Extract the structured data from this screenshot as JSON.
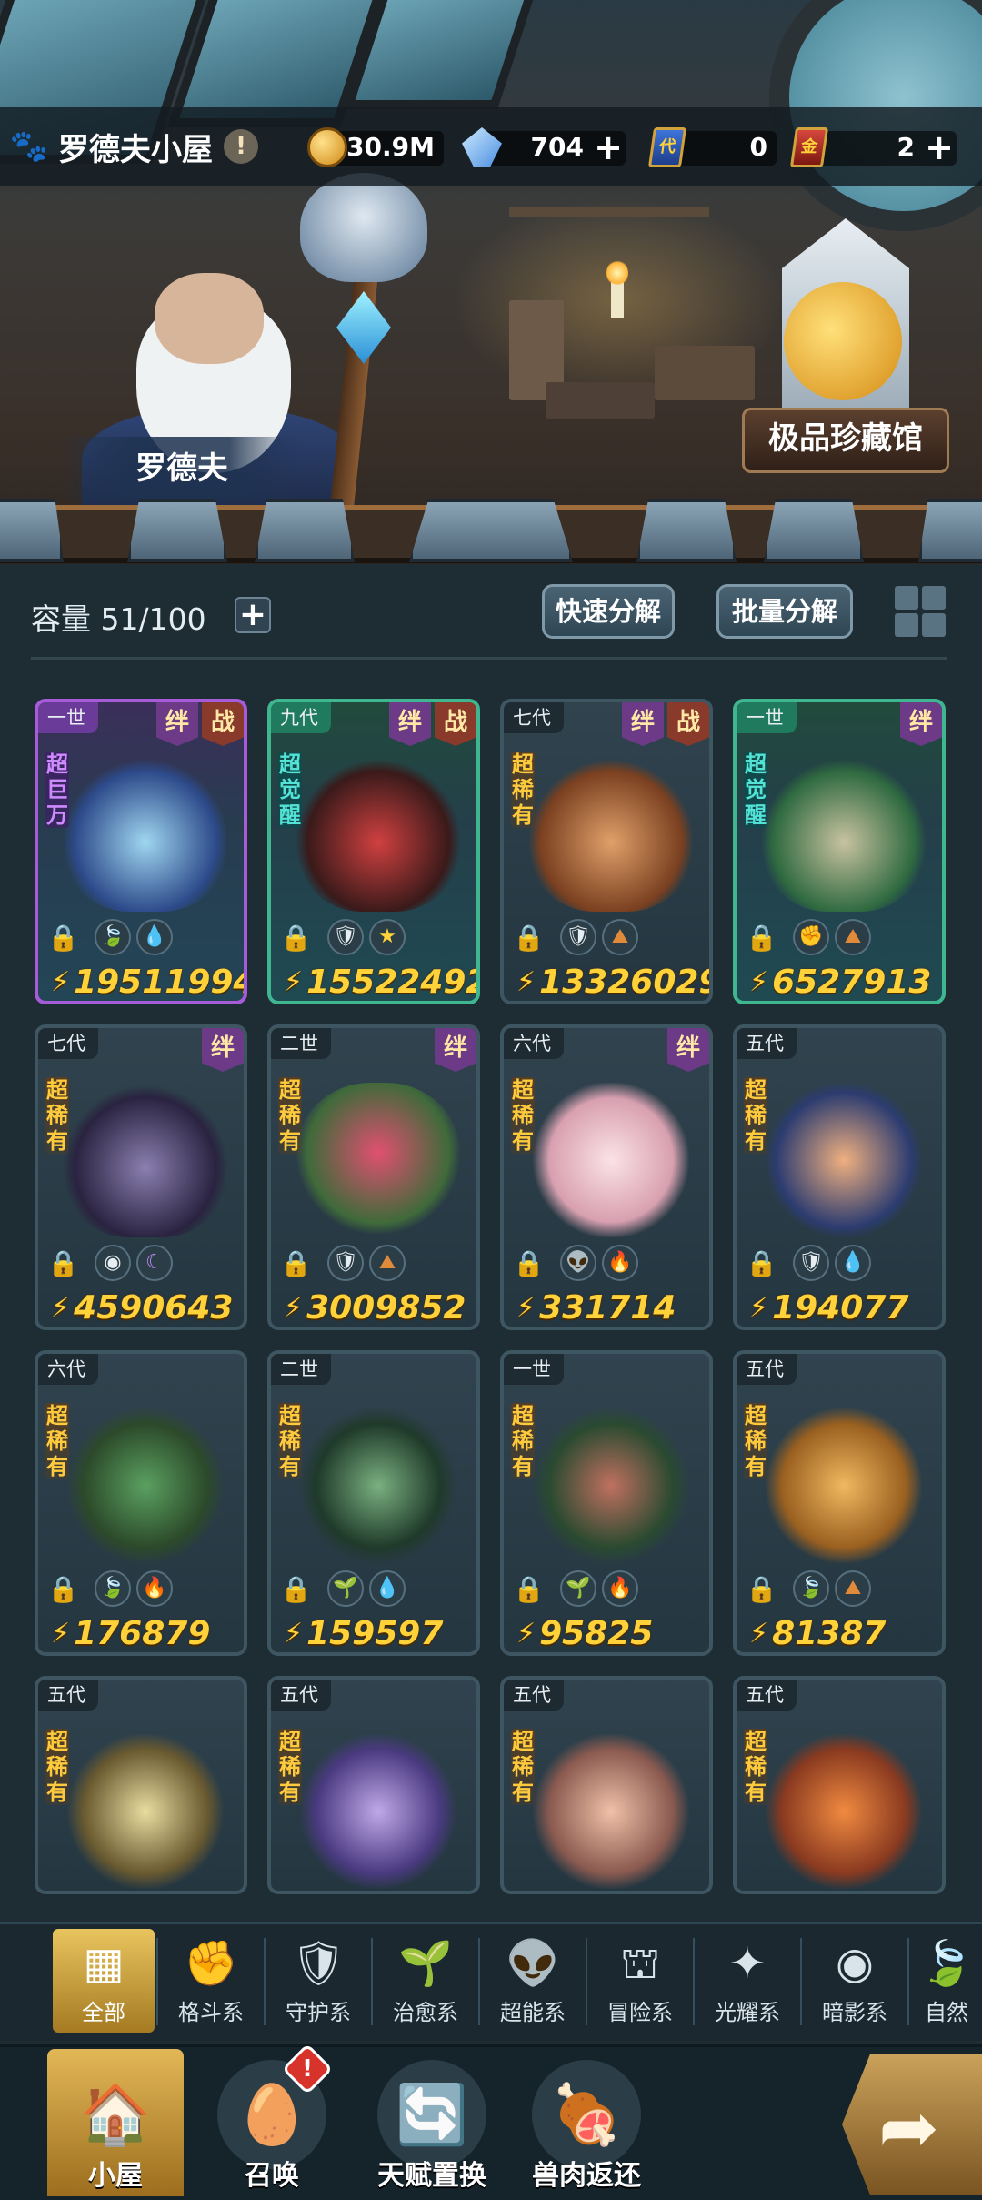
{
  "header": {
    "title": "罗德夫小屋",
    "resources": [
      {
        "icon": "gold-coin-icon",
        "value": "30.9M",
        "has_plus": false
      },
      {
        "icon": "crystal-gem-icon",
        "value": "704",
        "has_plus": true
      },
      {
        "icon": "blue-ticket-icon",
        "value": "0",
        "has_plus": false,
        "ticket_text": "代"
      },
      {
        "icon": "red-ticket-icon",
        "value": "2",
        "has_plus": true,
        "ticket_text": "金"
      }
    ]
  },
  "scene": {
    "character_name": "罗德夫",
    "gallery_button": "极品珍藏馆"
  },
  "storage": {
    "capacity_label": "容量 51/100",
    "quick_decompose": "快速分解",
    "batch_decompose": "批量分解"
  },
  "cards": [
    {
      "gen": "一世",
      "rarity": "超巨万",
      "power": "19511994",
      "badges": [
        "绊",
        "战"
      ],
      "elements": [
        "leaf",
        "water"
      ],
      "frame": "purple"
    },
    {
      "gen": "九代",
      "rarity": "超觉醒",
      "power": "15522492",
      "badges": [
        "绊",
        "战"
      ],
      "elements": [
        "shield",
        "star"
      ],
      "frame": "green"
    },
    {
      "gen": "七代",
      "rarity": "超稀有",
      "power": "13326029",
      "badges": [
        "绊",
        "战"
      ],
      "elements": [
        "shield",
        "earth"
      ],
      "frame": "normal"
    },
    {
      "gen": "一世",
      "rarity": "超觉醒",
      "power": "6527913",
      "badges": [
        "绊"
      ],
      "elements": [
        "fist",
        "earth"
      ],
      "frame": "green"
    },
    {
      "gen": "七代",
      "rarity": "超稀有",
      "power": "4590643",
      "badges": [
        "绊"
      ],
      "elements": [
        "eye",
        "moon"
      ],
      "frame": "normal"
    },
    {
      "gen": "二世",
      "rarity": "超稀有",
      "power": "3009852",
      "badges": [
        "绊"
      ],
      "elements": [
        "shield",
        "earth"
      ],
      "frame": "normal"
    },
    {
      "gen": "六代",
      "rarity": "超稀有",
      "power": "331714",
      "badges": [
        "绊"
      ],
      "elements": [
        "alien",
        "fire"
      ],
      "frame": "normal"
    },
    {
      "gen": "五代",
      "rarity": "超稀有",
      "power": "194077",
      "badges": [],
      "elements": [
        "shield",
        "water"
      ],
      "frame": "normal"
    },
    {
      "gen": "六代",
      "rarity": "超稀有",
      "power": "176879",
      "badges": [],
      "elements": [
        "leaf",
        "fire"
      ],
      "frame": "normal"
    },
    {
      "gen": "二世",
      "rarity": "超稀有",
      "power": "159597",
      "badges": [],
      "elements": [
        "sprout",
        "water"
      ],
      "frame": "normal"
    },
    {
      "gen": "一世",
      "rarity": "超稀有",
      "power": "95825",
      "badges": [],
      "elements": [
        "sprout",
        "fire"
      ],
      "frame": "normal"
    },
    {
      "gen": "五代",
      "rarity": "超稀有",
      "power": "81387",
      "badges": [],
      "elements": [
        "leaf",
        "earth"
      ],
      "frame": "normal"
    },
    {
      "gen": "五代",
      "rarity": "超稀有",
      "power": "",
      "badges": [],
      "elements": [],
      "frame": "normal"
    },
    {
      "gen": "五代",
      "rarity": "超稀有",
      "power": "",
      "badges": [],
      "elements": [],
      "frame": "normal"
    },
    {
      "gen": "五代",
      "rarity": "超稀有",
      "power": "",
      "badges": [],
      "elements": [],
      "frame": "normal"
    },
    {
      "gen": "五代",
      "rarity": "超稀有",
      "power": "",
      "badges": [],
      "elements": [],
      "frame": "normal"
    }
  ],
  "categories": [
    {
      "label": "全部",
      "icon": "all-blocks-icon",
      "active": true
    },
    {
      "label": "格斗系",
      "icon": "fist-icon",
      "active": false
    },
    {
      "label": "守护系",
      "icon": "shield-icon",
      "active": false
    },
    {
      "label": "治愈系",
      "icon": "sprout-icon",
      "active": false
    },
    {
      "label": "超能系",
      "icon": "alien-icon",
      "active": false
    },
    {
      "label": "冒险系",
      "icon": "tower-icon",
      "active": false
    },
    {
      "label": "光耀系",
      "icon": "sparkle-icon",
      "active": false
    },
    {
      "label": "暗影系",
      "icon": "eye-icon",
      "active": false
    },
    {
      "label": "自然",
      "icon": "leaf-icon",
      "active": false
    }
  ],
  "nav": [
    {
      "label": "小屋",
      "icon": "house-icon",
      "active": true
    },
    {
      "label": "召唤",
      "icon": "egg-icon",
      "active": false,
      "alert": "!"
    },
    {
      "label": "天赋置换",
      "icon": "swap-icon",
      "active": false
    },
    {
      "label": "兽肉返还",
      "icon": "meat-icon",
      "active": false
    }
  ],
  "colors": {
    "power_gold": "#ffd23a",
    "rarity_orange": "#ffcb3d",
    "frame_purple": "#a65bd9",
    "frame_green": "#3fb68f",
    "active_tab_gold": "#e8c45e"
  }
}
